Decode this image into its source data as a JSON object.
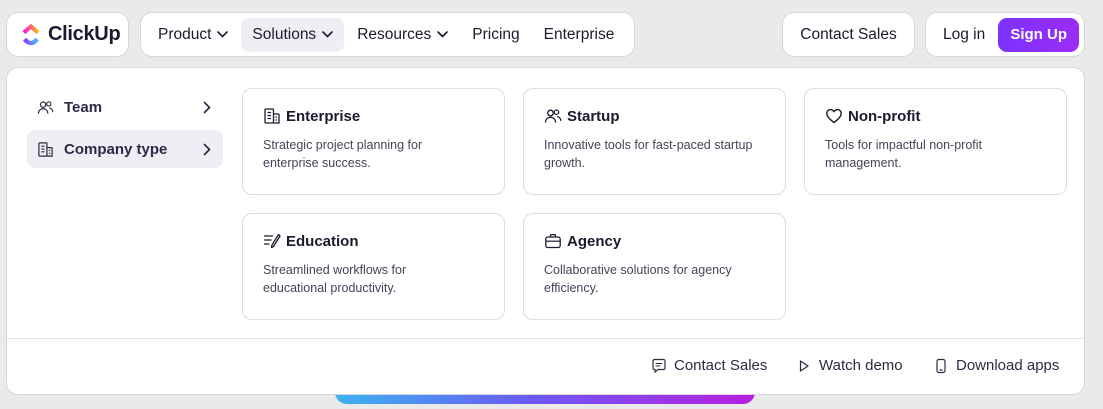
{
  "brand": {
    "name": "ClickUp"
  },
  "nav": {
    "items": [
      {
        "label": "Product",
        "has_dropdown": true
      },
      {
        "label": "Solutions",
        "has_dropdown": true,
        "active": true
      },
      {
        "label": "Resources",
        "has_dropdown": true
      },
      {
        "label": "Pricing",
        "has_dropdown": false
      },
      {
        "label": "Enterprise",
        "has_dropdown": false
      }
    ],
    "contact_sales": "Contact Sales",
    "login": "Log in",
    "signup": "Sign Up"
  },
  "menu": {
    "sidebar": [
      {
        "label": "Team",
        "icon": "team-icon"
      },
      {
        "label": "Company type",
        "icon": "building-icon",
        "active": true
      }
    ],
    "cards": [
      {
        "title": "Enterprise",
        "icon": "building-icon",
        "desc": "Strategic project planning for enterprise success."
      },
      {
        "title": "Startup",
        "icon": "people-icon",
        "desc": "Innovative tools for fast-paced startup growth."
      },
      {
        "title": "Non-profit",
        "icon": "heart-icon",
        "desc": "Tools for impactful non-profit management."
      },
      {
        "title": "Education",
        "icon": "list-pencil-icon",
        "desc": "Streamlined workflows for educational productivity."
      },
      {
        "title": "Agency",
        "icon": "briefcase-icon",
        "desc": "Collaborative solutions for agency efficiency."
      }
    ],
    "footer": [
      {
        "label": "Contact Sales",
        "icon": "chat-icon"
      },
      {
        "label": "Watch demo",
        "icon": "play-icon"
      },
      {
        "label": "Download apps",
        "icon": "phone-icon"
      }
    ]
  },
  "colors": {
    "signup_gradient_start": "#7b33ff",
    "signup_gradient_end": "#9b2cf5",
    "text_primary": "#1b1a2e",
    "active_bg": "#eeeef4"
  }
}
